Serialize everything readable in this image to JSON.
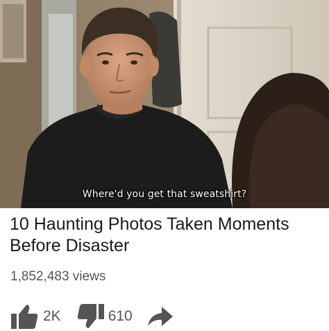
{
  "video": {
    "subtitle": "Where'd you get that sweatshirt?"
  },
  "details": {
    "title": "10 Haunting Photos Taken Moments Before Disaster",
    "views": "1,852,483 views"
  },
  "actions": {
    "like_count": "2K",
    "dislike_count": "610"
  },
  "icons": {
    "like": "thumbs-up-icon",
    "dislike": "thumbs-down-icon",
    "share": "share-arrow-icon"
  },
  "colors": {
    "icon": "#555555",
    "title": "#1a1a1a",
    "meta": "#555555"
  }
}
